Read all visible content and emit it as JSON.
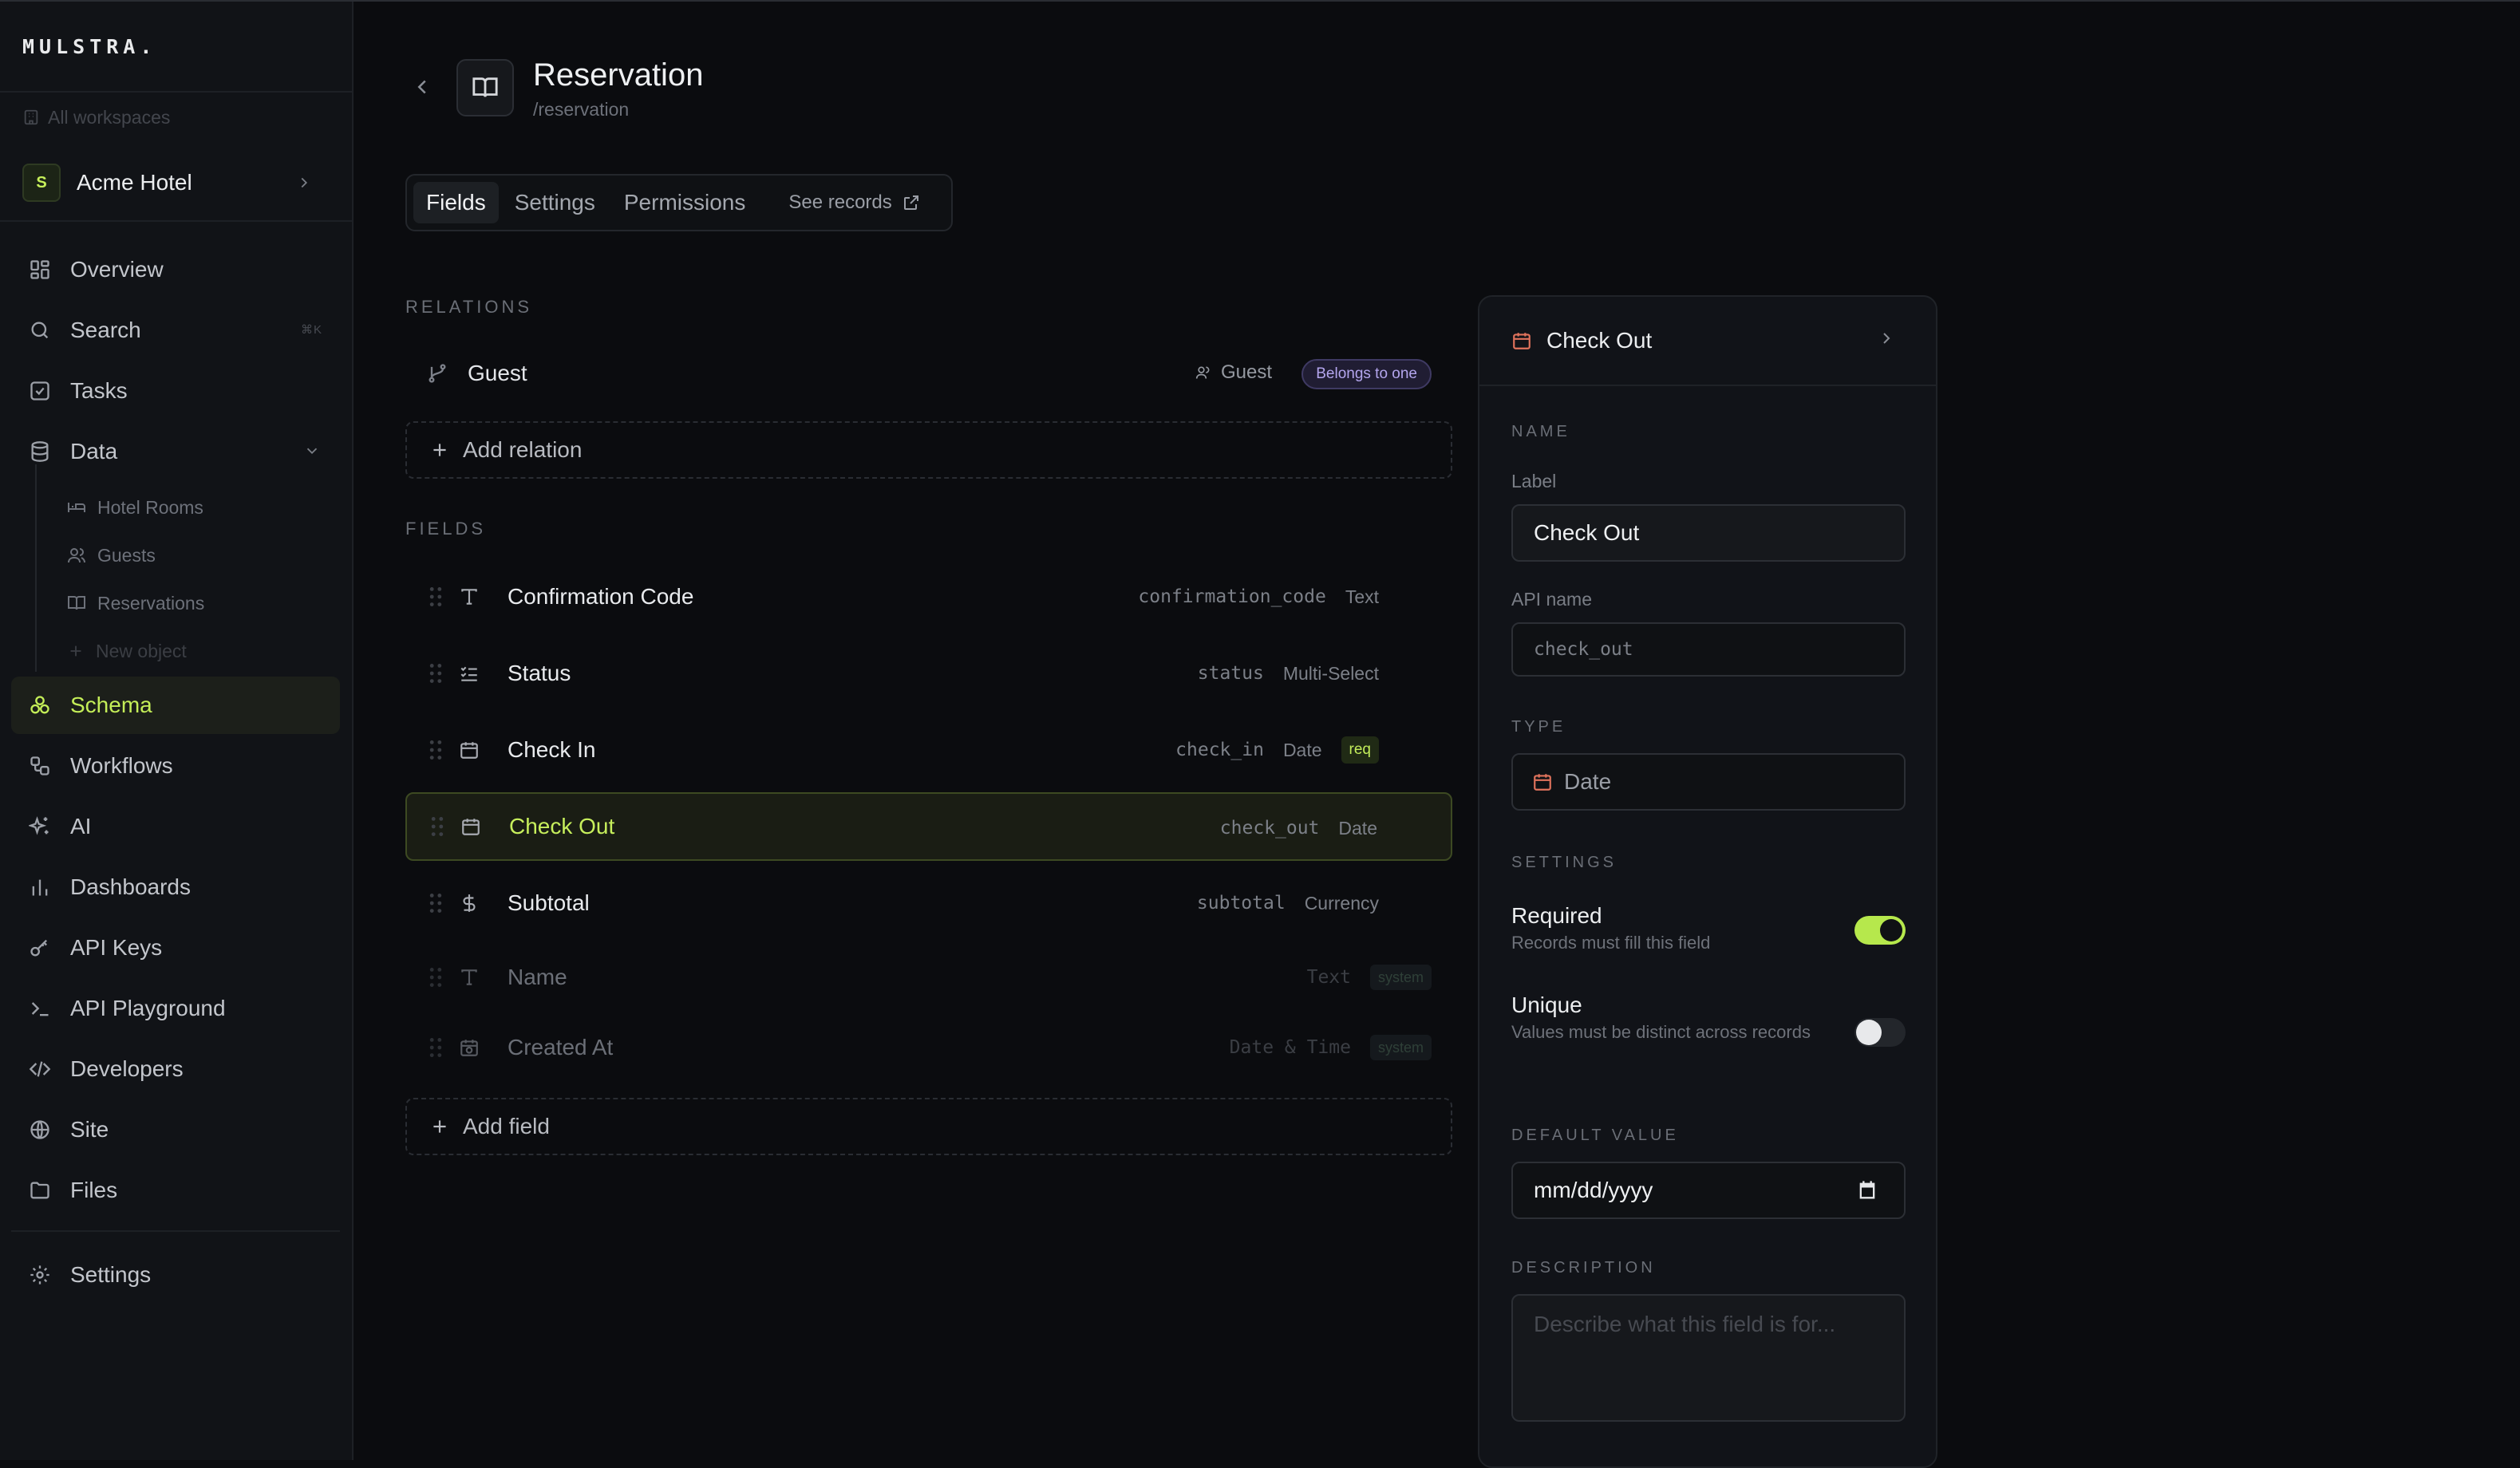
{
  "app": {
    "logo": "MULSTRA."
  },
  "sidebar": {
    "all_workspaces": "All workspaces",
    "workspace": {
      "badge": "S",
      "name": "Acme Hotel"
    },
    "nav": [
      {
        "label": "Overview",
        "icon": "grid-icon"
      },
      {
        "label": "Search",
        "icon": "search-icon",
        "shortcut": "⌘K"
      },
      {
        "label": "Tasks",
        "icon": "checkbox-icon"
      },
      {
        "label": "Data",
        "icon": "database-icon"
      },
      {
        "label": "Schema",
        "icon": "schema-icon",
        "active": true
      },
      {
        "label": "Workflows",
        "icon": "workflow-icon"
      },
      {
        "label": "AI",
        "icon": "sparkles-icon"
      },
      {
        "label": "Dashboards",
        "icon": "bar-chart-icon"
      },
      {
        "label": "API Keys",
        "icon": "key-icon"
      },
      {
        "label": "API Playground",
        "icon": "terminal-icon"
      },
      {
        "label": "Developers",
        "icon": "code-icon"
      },
      {
        "label": "Site",
        "icon": "globe-icon"
      },
      {
        "label": "Files",
        "icon": "folder-icon"
      },
      {
        "label": "Settings",
        "icon": "gear-icon"
      }
    ],
    "data_children": [
      {
        "label": "Hotel Rooms",
        "icon": "bed-icon"
      },
      {
        "label": "Guests",
        "icon": "users-icon"
      },
      {
        "label": "Reservations",
        "icon": "book-icon"
      },
      {
        "label": "New object",
        "icon": "plus-icon"
      }
    ]
  },
  "header": {
    "title": "Reservation",
    "slug": "/reservation",
    "icon": "book-open-icon"
  },
  "tabs": [
    {
      "label": "Fields",
      "active": true
    },
    {
      "label": "Settings"
    },
    {
      "label": "Permissions"
    },
    {
      "label": "See records",
      "icon": "external-link-icon"
    }
  ],
  "relations": {
    "section_label": "RELATIONS",
    "items": [
      {
        "name": "Guest",
        "target": "Guest",
        "kind": "Belongs to one"
      }
    ],
    "add_label": "Add relation"
  },
  "fields": {
    "section_label": "FIELDS",
    "items": [
      {
        "name": "Confirmation Code",
        "api": "confirmation_code",
        "type": "Text",
        "icon": "text-icon"
      },
      {
        "name": "Status",
        "api": "status",
        "type": "Multi-Select",
        "icon": "list-check-icon"
      },
      {
        "name": "Check In",
        "api": "check_in",
        "type": "Date",
        "badge": "req",
        "icon": "calendar-icon"
      },
      {
        "name": "Check Out",
        "api": "check_out",
        "type": "Date",
        "icon": "calendar-icon",
        "selected": true
      },
      {
        "name": "Subtotal",
        "api": "subtotal",
        "type": "Currency",
        "icon": "dollar-icon"
      },
      {
        "name": "Name",
        "api": "",
        "type": "Text",
        "badge": "system",
        "icon": "text-icon",
        "system": true
      },
      {
        "name": "Created At",
        "api": "",
        "type": "Date & Time",
        "badge": "system",
        "icon": "calendar-clock-icon",
        "system": true
      }
    ],
    "add_label": "Add field"
  },
  "panel": {
    "title": "Check Out",
    "name_section": "NAME",
    "label_caption": "Label",
    "label_value": "Check Out",
    "api_caption": "API name",
    "api_value": "check_out",
    "type_section": "TYPE",
    "type_value": "Date",
    "settings_section": "SETTINGS",
    "required": {
      "label": "Required",
      "desc": "Records must fill this field",
      "on": true
    },
    "unique": {
      "label": "Unique",
      "desc": "Values must be distinct across records",
      "on": false
    },
    "default_section": "DEFAULT VALUE",
    "default_placeholder": "mm/dd/yyyy",
    "description_section": "DESCRIPTION",
    "description_placeholder": "Describe what this field is for..."
  },
  "colors": {
    "accent": "#c4ee58",
    "background": "#0b0c0f",
    "sidebar": "#111317",
    "purple_badge": "#b4a6ee",
    "calendar_icon": "#e0735c"
  }
}
